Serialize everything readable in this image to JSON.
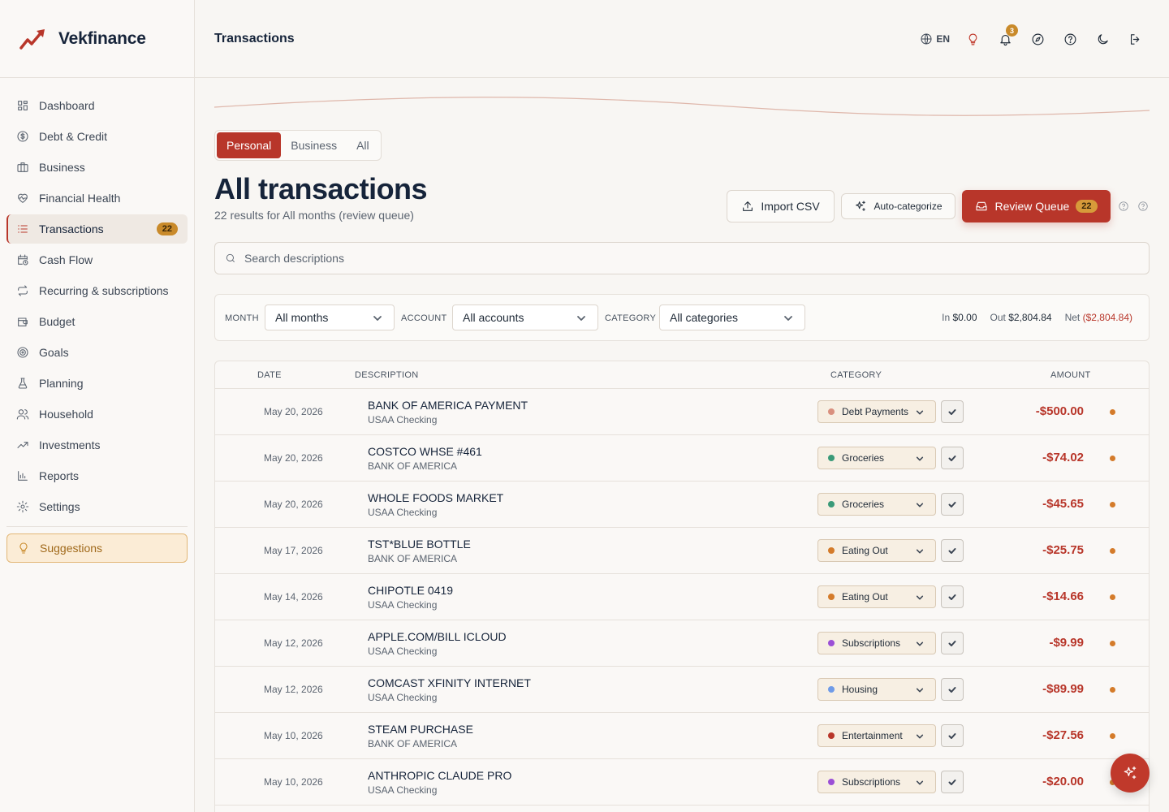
{
  "brand": {
    "name": "Vekfinance",
    "accent": "#b8362a"
  },
  "sidebar": {
    "items": [
      {
        "label": "Dashboard",
        "icon": "grid-icon"
      },
      {
        "label": "Debt & Credit",
        "icon": "dollar-circle-icon"
      },
      {
        "label": "Business",
        "icon": "briefcase-icon"
      },
      {
        "label": "Financial Health",
        "icon": "heart-pulse-icon"
      },
      {
        "label": "Transactions",
        "icon": "list-icon",
        "active": true,
        "badge": "22"
      },
      {
        "label": "Cash Flow",
        "icon": "calendar-clock-icon"
      },
      {
        "label": "Recurring & subscriptions",
        "icon": "repeat-icon"
      },
      {
        "label": "Budget",
        "icon": "wallet-icon"
      },
      {
        "label": "Goals",
        "icon": "target-icon"
      },
      {
        "label": "Planning",
        "icon": "flask-icon"
      },
      {
        "label": "Household",
        "icon": "users-icon"
      },
      {
        "label": "Investments",
        "icon": "trending-up-icon"
      },
      {
        "label": "Reports",
        "icon": "bar-chart-icon"
      },
      {
        "label": "Settings",
        "icon": "gear-icon"
      }
    ],
    "suggestions_label": "Suggestions"
  },
  "header": {
    "title": "Transactions",
    "language": "EN",
    "notification_count": "3"
  },
  "main": {
    "scope_tabs": [
      {
        "label": "Personal",
        "active": true
      },
      {
        "label": "Business",
        "active": false
      },
      {
        "label": "All",
        "active": false
      }
    ],
    "title": "All transactions",
    "subtitle": "22 results for All months (review queue)",
    "import_label": "Import CSV",
    "autocat_label": "Auto-categorize",
    "review_label": "Review Queue",
    "review_count": "22",
    "search_placeholder": "Search descriptions",
    "filters": {
      "month_label": "MONTH",
      "month_value": "All months",
      "account_label": "ACCOUNT",
      "account_value": "All accounts",
      "category_label": "CATEGORY",
      "category_value": "All categories",
      "in_label": "In",
      "in_value": "$0.00",
      "out_label": "Out",
      "out_value": "$2,804.84",
      "net_label": "Net",
      "net_value": "($2,804.84)"
    },
    "columns": {
      "date": "DATE",
      "description": "DESCRIPTION",
      "category": "CATEGORY",
      "amount": "AMOUNT"
    },
    "rows": [
      {
        "date": "May 20, 2026",
        "description": "BANK OF AMERICA PAYMENT",
        "account": "USAA Checking",
        "category": "Debt Payments",
        "cat_color": "#d9907e",
        "amount": "-$500.00"
      },
      {
        "date": "May 20, 2026",
        "description": "COSTCO WHSE #461",
        "account": "BANK OF AMERICA",
        "category": "Groceries",
        "cat_color": "#3a9a78",
        "amount": "-$74.02"
      },
      {
        "date": "May 20, 2026",
        "description": "WHOLE FOODS MARKET",
        "account": "USAA Checking",
        "category": "Groceries",
        "cat_color": "#3a9a78",
        "amount": "-$45.65"
      },
      {
        "date": "May 17, 2026",
        "description": "TST*BLUE BOTTLE",
        "account": "BANK OF AMERICA",
        "category": "Eating Out",
        "cat_color": "#d47b2a",
        "amount": "-$25.75"
      },
      {
        "date": "May 14, 2026",
        "description": "CHIPOTLE 0419",
        "account": "USAA Checking",
        "category": "Eating Out",
        "cat_color": "#d47b2a",
        "amount": "-$14.66"
      },
      {
        "date": "May 12, 2026",
        "description": "APPLE.COM/BILL ICLOUD",
        "account": "USAA Checking",
        "category": "Subscriptions",
        "cat_color": "#9b4fd6",
        "amount": "-$9.99"
      },
      {
        "date": "May 12, 2026",
        "description": "COMCAST XFINITY INTERNET",
        "account": "USAA Checking",
        "category": "Housing",
        "cat_color": "#6f9be8",
        "amount": "-$89.99"
      },
      {
        "date": "May 10, 2026",
        "description": "STEAM PURCHASE",
        "account": "BANK OF AMERICA",
        "category": "Entertainment",
        "cat_color": "#b8362a",
        "amount": "-$27.56"
      },
      {
        "date": "May 10, 2026",
        "description": "ANTHROPIC CLAUDE PRO",
        "account": "USAA Checking",
        "category": "Subscriptions",
        "cat_color": "#9b4fd6",
        "amount": "-$20.00"
      }
    ]
  }
}
